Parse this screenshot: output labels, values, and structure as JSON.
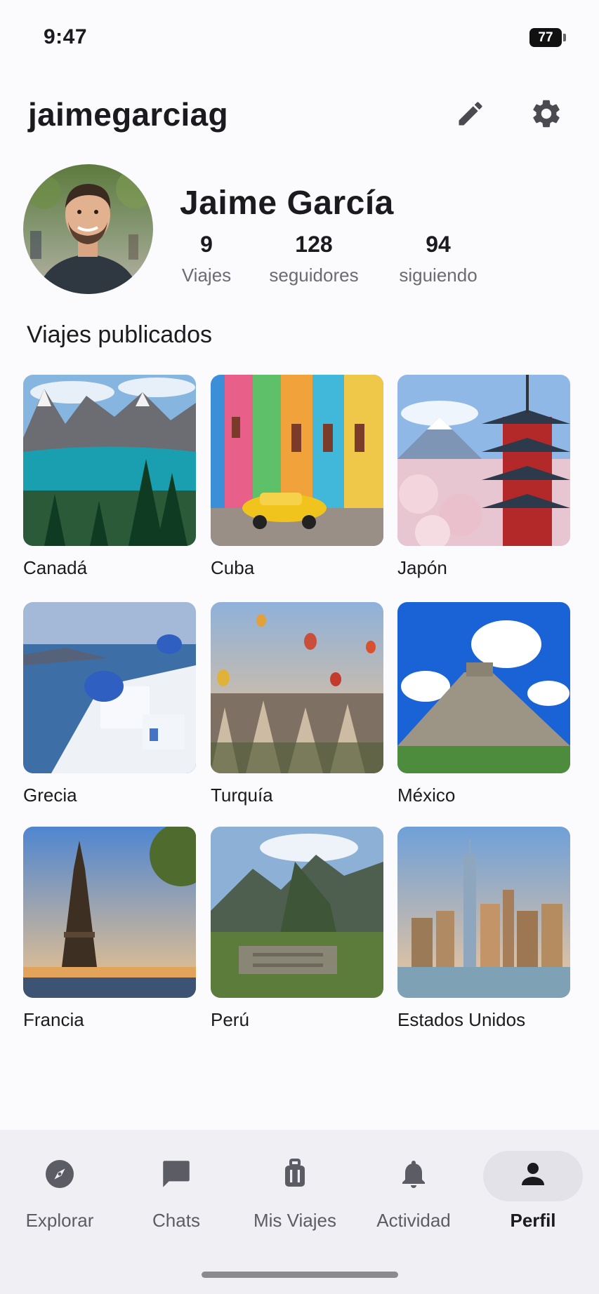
{
  "status_bar": {
    "time": "9:47",
    "battery": "77"
  },
  "header": {
    "username": "jaimegarciag",
    "edit_icon": "edit-pencil-icon",
    "settings_icon": "gear-icon"
  },
  "profile": {
    "name": "Jaime García",
    "stats": [
      {
        "value": "9",
        "label": "Viajes"
      },
      {
        "value": "128",
        "label": "seguidores"
      },
      {
        "value": "94",
        "label": "siguiendo"
      }
    ]
  },
  "trips": {
    "title": "Viajes publicados",
    "items": [
      {
        "label": "Canadá"
      },
      {
        "label": "Cuba"
      },
      {
        "label": "Japón"
      },
      {
        "label": "Grecia"
      },
      {
        "label": "Turquía"
      },
      {
        "label": "México"
      },
      {
        "label": "Francia"
      },
      {
        "label": "Perú"
      },
      {
        "label": "Estados Unidos"
      }
    ]
  },
  "bottom_nav": {
    "items": [
      {
        "label": "Explorar",
        "icon": "compass-icon"
      },
      {
        "label": "Chats",
        "icon": "chat-icon"
      },
      {
        "label": "Mis Viajes",
        "icon": "luggage-icon"
      },
      {
        "label": "Actividad",
        "icon": "bell-icon"
      },
      {
        "label": "Perfil",
        "icon": "person-icon"
      }
    ],
    "active": "Perfil"
  },
  "colors": {
    "background": "#fbfafd",
    "nav_background": "#f0eff4",
    "active_pill": "#e3e2e8",
    "text": "#1b1b1f",
    "muted": "#6b6b72"
  }
}
